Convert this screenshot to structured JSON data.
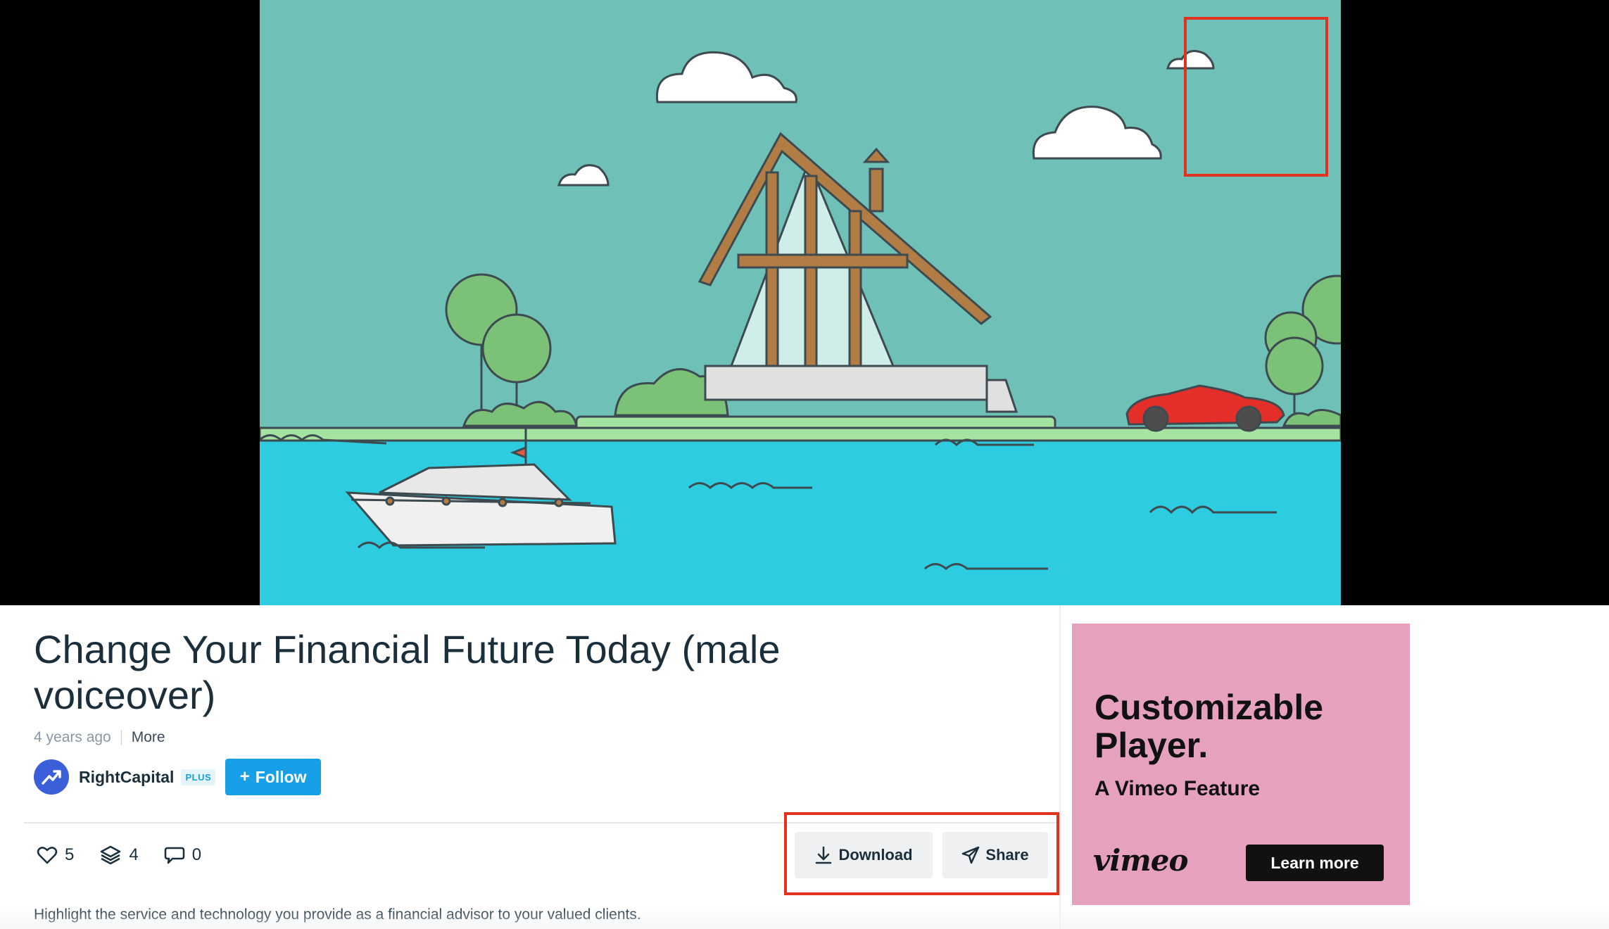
{
  "video": {
    "title": "Change Your Financial Future Today (male voiceover)",
    "age": "4 years ago",
    "more_label": "More",
    "description": "Highlight the service and technology you provide as a financial advisor to your valued clients."
  },
  "channel": {
    "name": "RightCapital",
    "badge": "PLUS",
    "follow_plus": "+",
    "follow_label": "Follow",
    "avatar_icon": "trending-up-icon"
  },
  "stats": {
    "likes": "5",
    "collections": "4",
    "comments": "0",
    "icons": [
      "heart-icon",
      "layers-icon",
      "comment-icon"
    ]
  },
  "actions": {
    "download_label": "Download",
    "share_label": "Share"
  },
  "ad": {
    "title": "Customizable Player.",
    "subtitle": "A Vimeo Feature",
    "logo": "vimeo",
    "cta_label": "Learn more",
    "background": "#e6a1bf"
  },
  "colors": {
    "accent": "#17a0e8",
    "annotation": "#e0321f",
    "sky": "#6fc1b8",
    "water": "#2ecce0"
  }
}
